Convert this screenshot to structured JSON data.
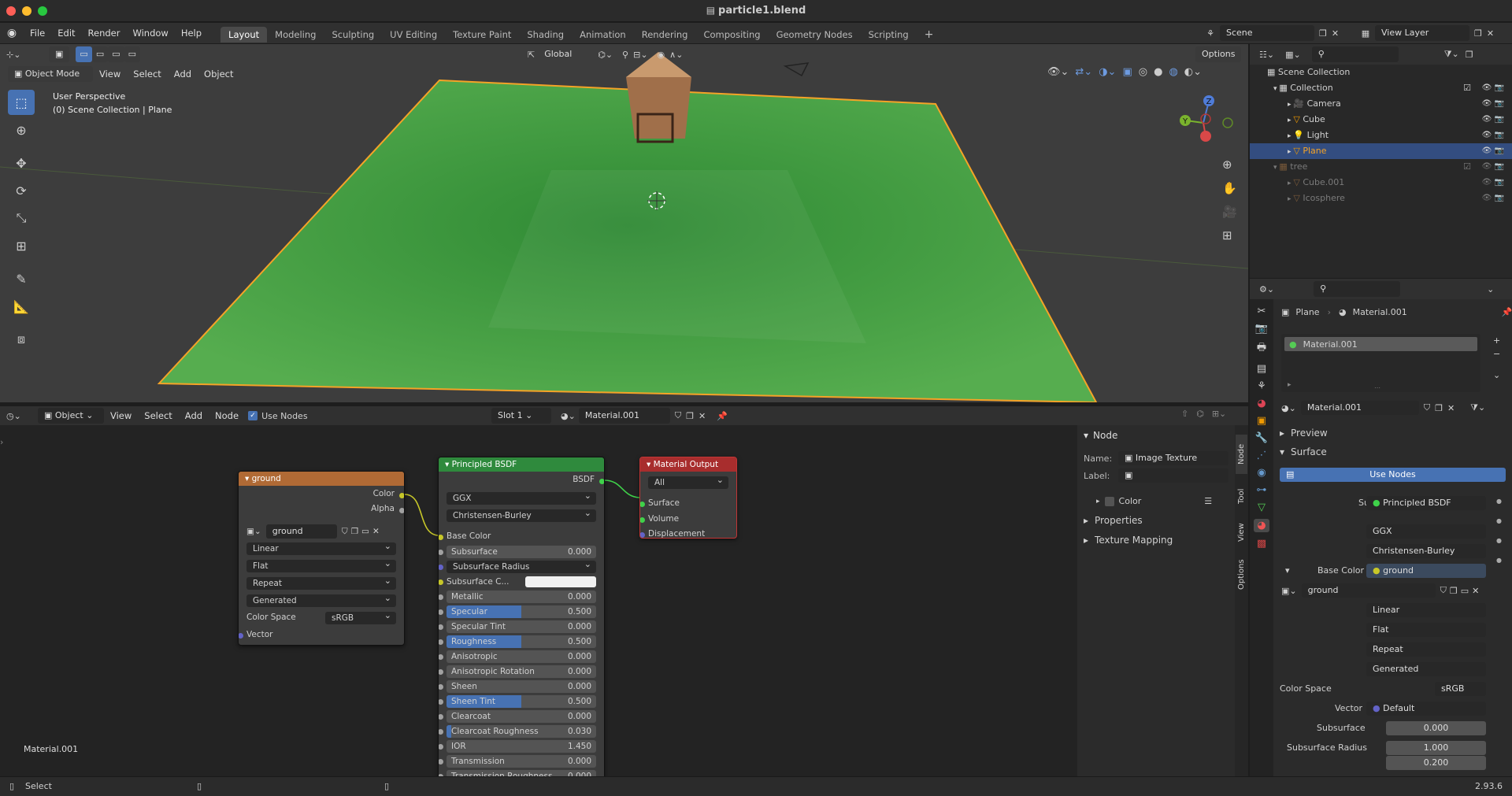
{
  "window": {
    "title": "particle1.blend"
  },
  "topbar": {
    "menus": [
      "File",
      "Edit",
      "Render",
      "Window",
      "Help"
    ],
    "workspaces": [
      "Layout",
      "Modeling",
      "Sculpting",
      "UV Editing",
      "Texture Paint",
      "Shading",
      "Animation",
      "Rendering",
      "Compositing",
      "Geometry Nodes",
      "Scripting"
    ],
    "active_workspace": "Layout",
    "scene": "Scene",
    "view_layer": "View Layer"
  },
  "viewport": {
    "mode": "Object Mode",
    "menus": [
      "View",
      "Select",
      "Add",
      "Object"
    ],
    "transform_orientation": "Global",
    "options_label": "Options",
    "perspective_label": "User Perspective",
    "context_label": "(0) Scene Collection | Plane",
    "gizmo_axes": [
      "Z",
      "Y",
      "X"
    ]
  },
  "node_editor": {
    "editor_type": "Object",
    "menus": [
      "View",
      "Select",
      "Add",
      "Node"
    ],
    "use_nodes_label": "Use Nodes",
    "use_nodes_checked": true,
    "slot": "Slot 1",
    "material": "Material.001",
    "corner_label": "Material.001",
    "image_node": {
      "title": "ground",
      "outputs": [
        "Color",
        "Alpha"
      ],
      "image": "ground",
      "interpolation": "Linear",
      "projection": "Flat",
      "extension": "Repeat",
      "source": "Generated",
      "color_space_label": "Color Space",
      "color_space": "sRGB",
      "input": "Vector"
    },
    "bsdf_node": {
      "title": "Principled BSDF",
      "output": "BSDF",
      "distribution": "GGX",
      "subsurface_method": "Christensen-Burley",
      "base_color_label": "Base Color",
      "sliders": [
        {
          "label": "Subsurface",
          "value": "0.000",
          "fill": 0
        },
        {
          "label": "Subsurface Radius",
          "value": "",
          "fill": 0,
          "dropdown": true
        },
        {
          "label": "Subsurface C...",
          "value": "",
          "fill": 0,
          "color": true
        },
        {
          "label": "Metallic",
          "value": "0.000",
          "fill": 0
        },
        {
          "label": "Specular",
          "value": "0.500",
          "fill": 0.5
        },
        {
          "label": "Specular Tint",
          "value": "0.000",
          "fill": 0
        },
        {
          "label": "Roughness",
          "value": "0.500",
          "fill": 0.5
        },
        {
          "label": "Anisotropic",
          "value": "0.000",
          "fill": 0
        },
        {
          "label": "Anisotropic Rotation",
          "value": "0.000",
          "fill": 0
        },
        {
          "label": "Sheen",
          "value": "0.000",
          "fill": 0
        },
        {
          "label": "Sheen Tint",
          "value": "0.500",
          "fill": 0.5
        },
        {
          "label": "Clearcoat",
          "value": "0.000",
          "fill": 0
        },
        {
          "label": "Clearcoat Roughness",
          "value": "0.030",
          "fill": 0.03
        },
        {
          "label": "IOR",
          "value": "1.450",
          "fill": 0
        },
        {
          "label": "Transmission",
          "value": "0.000",
          "fill": 0
        },
        {
          "label": "Transmission Roughness",
          "value": "0.000",
          "fill": 0
        }
      ]
    },
    "output_node": {
      "title": "Material Output",
      "target": "All",
      "inputs": [
        "Surface",
        "Volume",
        "Displacement"
      ]
    }
  },
  "n_panel": {
    "section": "Node",
    "name_label": "Name:",
    "name_value": "Image Texture",
    "label_label": "Label:",
    "label_value": "",
    "color_label": "Color",
    "properties_label": "Properties",
    "texture_mapping_label": "Texture Mapping",
    "tabs": [
      "Node",
      "Tool",
      "View",
      "Options"
    ]
  },
  "outliner": {
    "root": "Scene Collection",
    "rows": [
      {
        "name": "Collection",
        "indent": 1,
        "type": "collection",
        "selected": false,
        "dim": false
      },
      {
        "name": "Camera",
        "indent": 2,
        "type": "camera",
        "selected": false,
        "dim": false
      },
      {
        "name": "Cube",
        "indent": 2,
        "type": "mesh",
        "selected": false,
        "dim": false
      },
      {
        "name": "Light",
        "indent": 2,
        "type": "light",
        "selected": false,
        "dim": false
      },
      {
        "name": "Plane",
        "indent": 2,
        "type": "mesh",
        "selected": true,
        "dim": false
      },
      {
        "name": "tree",
        "indent": 1,
        "type": "collection",
        "selected": false,
        "dim": true
      },
      {
        "name": "Cube.001",
        "indent": 2,
        "type": "mesh",
        "selected": false,
        "dim": true
      },
      {
        "name": "Icosphere",
        "indent": 2,
        "type": "mesh",
        "selected": false,
        "dim": true
      }
    ]
  },
  "properties": {
    "breadcrumb_object": "Plane",
    "breadcrumb_material": "Material.001",
    "material_slot": "Material.001",
    "material_name": "Material.001",
    "preview_label": "Preview",
    "surface_section": "Surface",
    "use_nodes_button": "Use Nodes",
    "surface_label": "Surface",
    "surface_value": "Principled BSDF",
    "distribution": "GGX",
    "subsurface_method": "Christensen-Burley",
    "base_color_label": "Base Color",
    "base_color_value": "ground",
    "image_name": "ground",
    "interpolation": "Linear",
    "projection": "Flat",
    "extension": "Repeat",
    "source": "Generated",
    "color_space_label": "Color Space",
    "color_space": "sRGB",
    "vector_label": "Vector",
    "vector_value": "Default",
    "subsurface_label": "Subsurface",
    "subsurface_value": "0.000",
    "subsurface_radius_label": "Subsurface Radius",
    "subsurface_radius_values": [
      "1.000",
      "0.200"
    ]
  },
  "statusbar": {
    "left": "Select",
    "version": "2.93.6"
  },
  "colors": {
    "accent": "#4772b3",
    "image_node_header": "#b06a35",
    "bsdf_node_header": "#2f8a3d",
    "output_node_header": "#a82d2d",
    "plane_green": "#3e9b3a",
    "selection_orange": "#f5a327"
  }
}
